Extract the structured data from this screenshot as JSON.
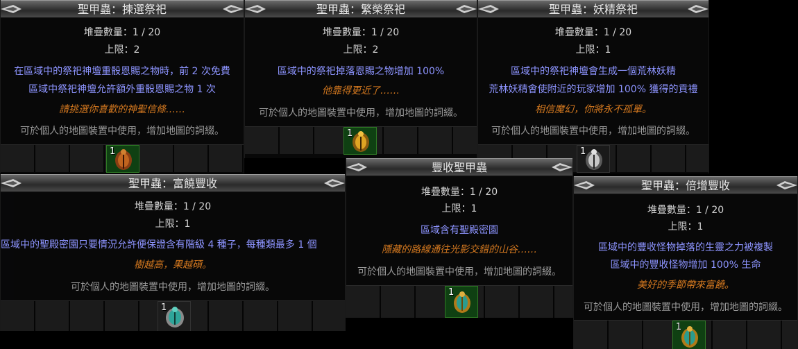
{
  "common": {
    "stack_label": "堆疊數量：",
    "limit_label": "上限：",
    "usage_hint": "可於個人的地圖裝置中使用，增加地圖的詞綴。"
  },
  "colors": {
    "property": "#d4d4d4",
    "modifier": "#8d94ff",
    "flavor": "#d3781f",
    "hint": "#9a9a9a",
    "slot_green": "#0f4012"
  },
  "cards": [
    {
      "title": "聖甲蟲：揀選祭祀",
      "stack": "1 / 20",
      "limit": "2",
      "mods": [
        "在區域中的祭祀神壇重骰恩賜之物時，前 2 次免費",
        "區域中祭祀神壇允許額外重骰恩賜之物 1 次"
      ],
      "flavor": "請挑選你喜歡的神聖信條……",
      "icon_count": "1",
      "icon": "bronze-scarab-icon"
    },
    {
      "title": "聖甲蟲：繁榮祭祀",
      "stack": "1 / 20",
      "limit": "2",
      "mods": [
        "區域中的祭祀掉落恩賜之物增加 100%"
      ],
      "flavor": "他靠得更近了……",
      "icon_count": "1",
      "icon": "gold-scarab-icon"
    },
    {
      "title": "聖甲蟲：妖精祭祀",
      "stack": "1 / 20",
      "limit": "1",
      "mods": [
        "區域中的祭祀神壇會生成一個荒林妖精",
        "荒林妖精會使附近的玩家增加 100% 獲得的貢禮"
      ],
      "flavor": "相信魔幻，你將永不孤單。",
      "icon_count": "1",
      "icon": "silver-scarab-icon"
    },
    {
      "title": "聖甲蟲：富饒豐收",
      "stack": "1 / 20",
      "limit": "1",
      "mods": [
        "區域中的聖殿密園只要情況允許便保證含有階級 4 種子，每種類最多 1 個"
      ],
      "flavor": "樹越高，果越碩。",
      "icon_count": "1",
      "icon": "teal-scarab-icon"
    },
    {
      "title": "豐收聖甲蟲",
      "stack": "1 / 20",
      "limit": "1",
      "mods": [
        "區域含有聖殿密園"
      ],
      "flavor": "隱藏的路線通往光影交錯的山谷……",
      "icon_count": "1",
      "icon": "teal-gold-scarab-icon"
    },
    {
      "title": "聖甲蟲：倍增豐收",
      "stack": "1 / 20",
      "limit": "1",
      "mods": [
        "區域中的豐收怪物掉落的生靈之力被複製",
        "區域中的豐收怪物增加 100% 生命"
      ],
      "flavor": "美好的季節帶來富饒。",
      "icon_count": "1",
      "icon": "teal-gold-scarab-icon"
    }
  ]
}
